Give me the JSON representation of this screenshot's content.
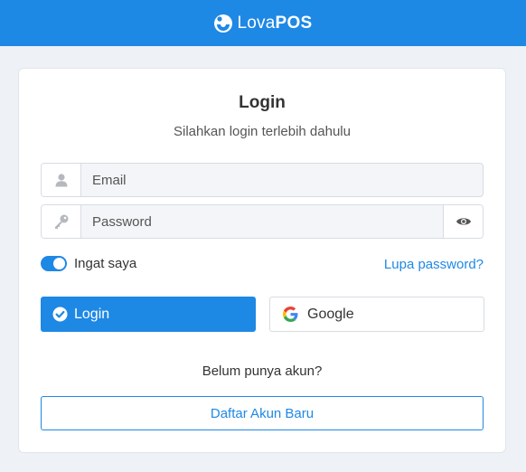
{
  "header": {
    "brand_part1": "Lova",
    "brand_part2": "POS",
    "logo_icon": "lova-logo-icon",
    "background_color": "#1e88e5"
  },
  "login_card": {
    "title": "Login",
    "subtitle": "Silahkan login terlebih dahulu",
    "email": {
      "placeholder": "Email",
      "value": "",
      "icon": "user-icon"
    },
    "password": {
      "placeholder": "Password",
      "value": "",
      "icon": "key-icon",
      "toggle_icon": "eye-icon"
    },
    "remember": {
      "label": "Ingat saya",
      "checked": true
    },
    "forgot_password": "Lupa password?",
    "login_button": {
      "label": "Login",
      "icon": "check-circle-icon"
    },
    "google_button": {
      "label": "Google",
      "icon": "google-icon"
    },
    "no_account_text": "Belum punya akun?",
    "register_button": "Daftar Akun Baru"
  },
  "colors": {
    "accent": "#1e88e5",
    "page_background": "#eef1f5"
  }
}
